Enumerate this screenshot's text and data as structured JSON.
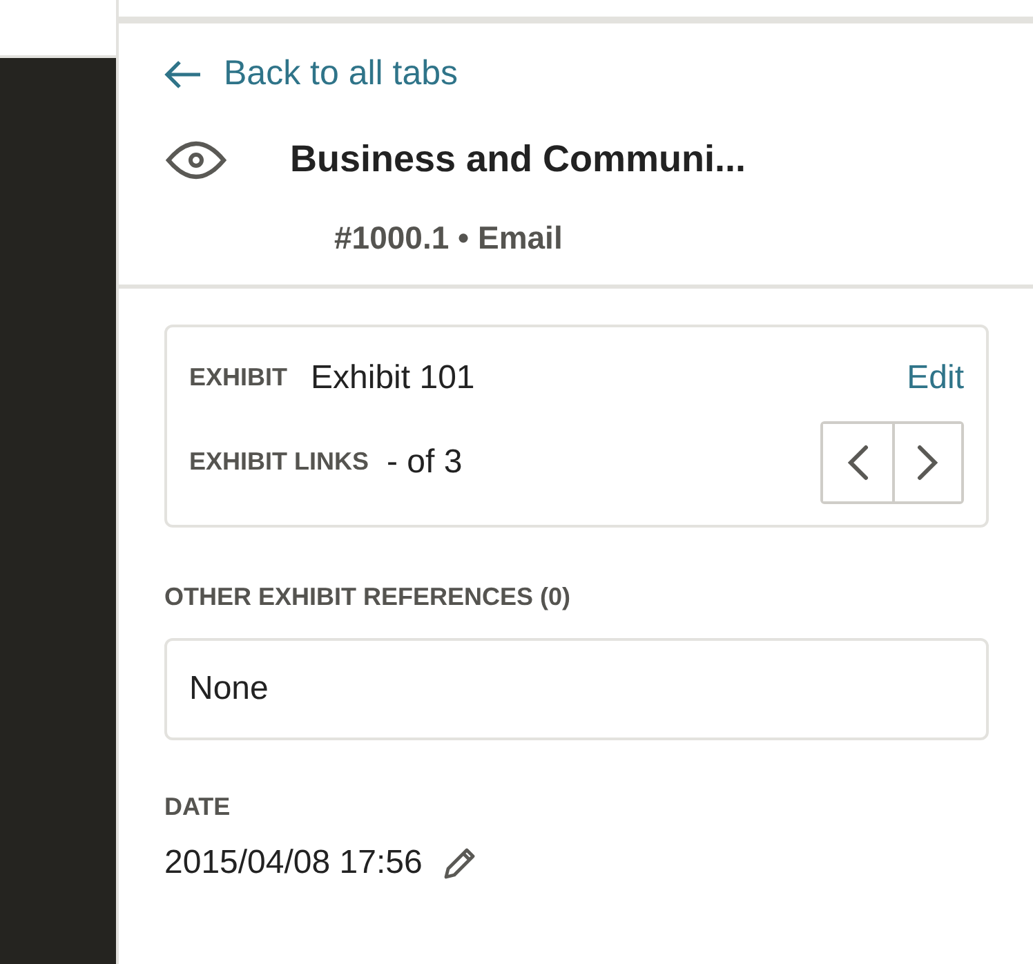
{
  "back_link": "Back to all tabs",
  "document": {
    "title": "Business and Communi...",
    "subtitle": "#1000.1 • Email"
  },
  "exhibit": {
    "label": "EXHIBIT",
    "value": "Exhibit 101",
    "edit": "Edit",
    "links_label": "EXHIBIT LINKS",
    "links_value": "- of 3"
  },
  "other_references": {
    "label": "OTHER EXHIBIT REFERENCES (0)",
    "value": "None"
  },
  "date": {
    "label": "DATE",
    "value": "2015/04/08 17:56"
  }
}
